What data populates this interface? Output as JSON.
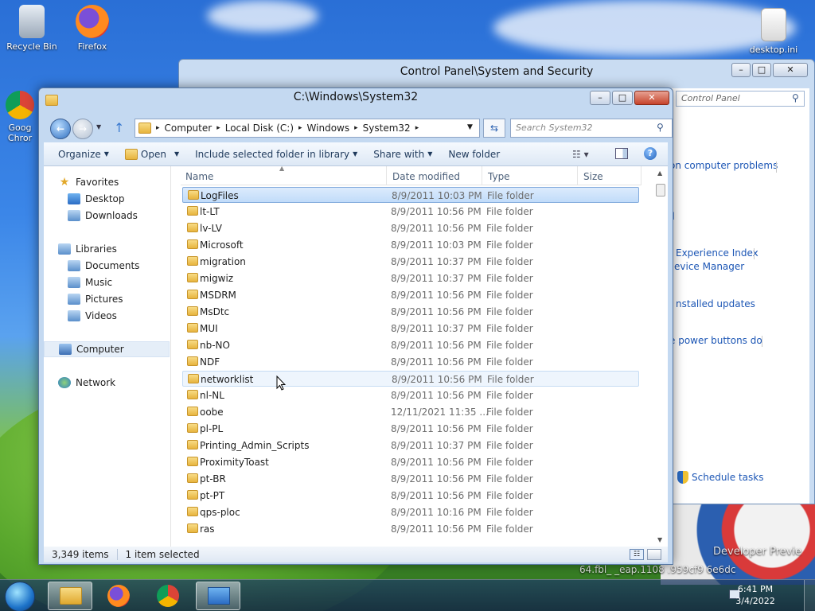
{
  "desktop": {
    "icons": [
      {
        "label": "Recycle Bin"
      },
      {
        "label": "Firefox"
      },
      {
        "label": "Goog Chror"
      },
      {
        "label": "desktop.ini"
      }
    ],
    "watermark_line1": "Developer Previe",
    "watermark_line2": "64.fbl_ _eap.1108 .959cf9 6e6dc"
  },
  "control_panel": {
    "title": "Control Panel\\System and Security",
    "search_placeholder": "Control Panel",
    "links": [
      "on computer problems",
      "Experience Index",
      "evice Manager",
      "nstalled updates",
      "e power buttons do",
      "Schedule tasks"
    ],
    "partial_link": "ll"
  },
  "explorer": {
    "title": "C:\\Windows\\System32",
    "breadcrumb": [
      "Computer",
      "Local Disk (C:)",
      "Windows",
      "System32"
    ],
    "search_placeholder": "Search System32",
    "toolbar": {
      "organize": "Organize",
      "open": "Open",
      "include": "Include selected folder in library",
      "share": "Share with",
      "new_folder": "New folder"
    },
    "nav": {
      "favorites": "Favorites",
      "desktop": "Desktop",
      "downloads": "Downloads",
      "libraries": "Libraries",
      "documents": "Documents",
      "music": "Music",
      "pictures": "Pictures",
      "videos": "Videos",
      "computer": "Computer",
      "network": "Network"
    },
    "columns": {
      "name": "Name",
      "date": "Date modified",
      "type": "Type",
      "size": "Size"
    },
    "rows": [
      {
        "name": "LogFiles",
        "date": "8/9/2011 10:03 PM",
        "type": "File folder"
      },
      {
        "name": "lt-LT",
        "date": "8/9/2011 10:56 PM",
        "type": "File folder"
      },
      {
        "name": "lv-LV",
        "date": "8/9/2011 10:56 PM",
        "type": "File folder"
      },
      {
        "name": "Microsoft",
        "date": "8/9/2011 10:03 PM",
        "type": "File folder"
      },
      {
        "name": "migration",
        "date": "8/9/2011 10:37 PM",
        "type": "File folder"
      },
      {
        "name": "migwiz",
        "date": "8/9/2011 10:37 PM",
        "type": "File folder"
      },
      {
        "name": "MSDRM",
        "date": "8/9/2011 10:56 PM",
        "type": "File folder"
      },
      {
        "name": "MsDtc",
        "date": "8/9/2011 10:56 PM",
        "type": "File folder"
      },
      {
        "name": "MUI",
        "date": "8/9/2011 10:37 PM",
        "type": "File folder"
      },
      {
        "name": "nb-NO",
        "date": "8/9/2011 10:56 PM",
        "type": "File folder"
      },
      {
        "name": "NDF",
        "date": "8/9/2011 10:56 PM",
        "type": "File folder"
      },
      {
        "name": "networklist",
        "date": "8/9/2011 10:56 PM",
        "type": "File folder"
      },
      {
        "name": "nl-NL",
        "date": "8/9/2011 10:56 PM",
        "type": "File folder"
      },
      {
        "name": "oobe",
        "date": "12/11/2021 11:35 ...",
        "type": "File folder"
      },
      {
        "name": "pl-PL",
        "date": "8/9/2011 10:56 PM",
        "type": "File folder"
      },
      {
        "name": "Printing_Admin_Scripts",
        "date": "8/9/2011 10:37 PM",
        "type": "File folder"
      },
      {
        "name": "ProximityToast",
        "date": "8/9/2011 10:56 PM",
        "type": "File folder"
      },
      {
        "name": "pt-BR",
        "date": "8/9/2011 10:56 PM",
        "type": "File folder"
      },
      {
        "name": "pt-PT",
        "date": "8/9/2011 10:56 PM",
        "type": "File folder"
      },
      {
        "name": "qps-ploc",
        "date": "8/9/2011 10:16 PM",
        "type": "File folder"
      },
      {
        "name": "ras",
        "date": "8/9/2011 10:56 PM",
        "type": "File folder"
      }
    ],
    "status": {
      "count": "3,349 items",
      "selected": "1 item selected"
    }
  },
  "taskbar": {
    "time": "6:41 PM",
    "date": "3/4/2022",
    "apps": [
      "file-explorer-icon",
      "firefox-icon",
      "chrome-icon",
      "control-panel-icon"
    ]
  }
}
